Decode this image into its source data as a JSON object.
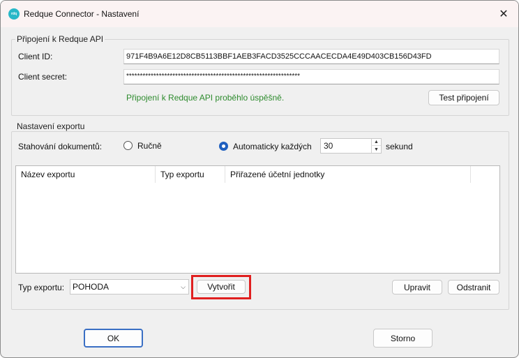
{
  "window": {
    "title": "Redque Connector - Nastavení",
    "app_icon_text": "rdq",
    "close_glyph": "✕"
  },
  "api_group": {
    "label": "Připojení k Redque API",
    "client_id_label": "Client ID:",
    "client_id_value": "971F4B9A6E12D8CB5113BBF1AEB3FACD3525CCCAACECDA4E49D403CB156D43FD",
    "client_secret_label": "Client secret:",
    "client_secret_value": "****************************************************************",
    "status_message": "Připojení k Redque API proběhlo úspěšně.",
    "test_button": "Test připojení"
  },
  "export_group": {
    "label": "Nastavení exportu",
    "download_label": "Stahování dokumentů:",
    "option_manual": "Ručně",
    "option_auto": "Automaticky každých",
    "selected_option": "auto",
    "interval_value": "30",
    "interval_unit": "sekund",
    "columns": [
      "Název exportu",
      "Typ exportu",
      "Přiřazené účetní jednotky"
    ],
    "rows": [],
    "type_label": "Typ exportu:",
    "type_selected": "POHODA",
    "create_button": "Vytvořit",
    "edit_button": "Upravit",
    "remove_button": "Odstranit"
  },
  "footer": {
    "ok_button": "OK",
    "cancel_button": "Storno"
  },
  "colors": {
    "success_text": "#2e8b2e",
    "highlight": "#e02020",
    "accent": "#1f5fbf"
  }
}
